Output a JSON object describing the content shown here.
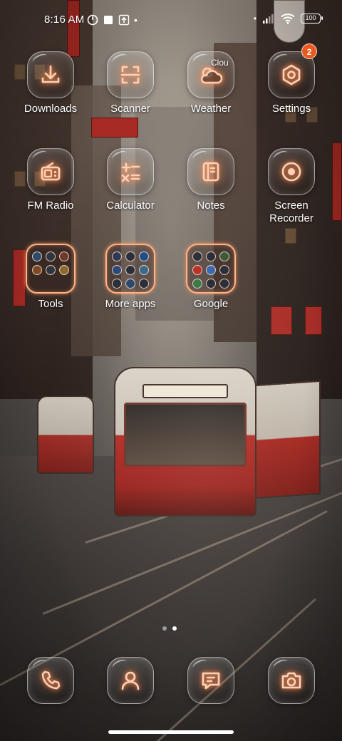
{
  "status_bar": {
    "time": "8:16 AM",
    "battery": "100"
  },
  "apps": [
    {
      "id": "downloads",
      "label": "Downloads",
      "icon": "download-icon"
    },
    {
      "id": "scanner",
      "label": "Scanner",
      "icon": "scanner-icon"
    },
    {
      "id": "weather",
      "label": "Weather",
      "icon": "weather-cloud-icon",
      "overlay_text": "Clou"
    },
    {
      "id": "settings",
      "label": "Settings",
      "icon": "gear-icon",
      "badge": "2"
    },
    {
      "id": "fm_radio",
      "label": "FM Radio",
      "icon": "radio-icon"
    },
    {
      "id": "calculator",
      "label": "Calculator",
      "icon": "calculator-icon"
    },
    {
      "id": "notes",
      "label": "Notes",
      "icon": "notes-icon"
    },
    {
      "id": "screen_recorder",
      "label": "Screen\nRecorder",
      "icon": "record-icon"
    }
  ],
  "folders": [
    {
      "id": "tools",
      "label": "Tools"
    },
    {
      "id": "more_apps",
      "label": "More apps"
    },
    {
      "id": "google",
      "label": "Google"
    }
  ],
  "dock": [
    {
      "id": "phone",
      "icon": "phone-icon"
    },
    {
      "id": "contacts",
      "icon": "contacts-icon"
    },
    {
      "id": "messages",
      "icon": "messages-icon"
    },
    {
      "id": "camera",
      "icon": "camera-icon"
    }
  ],
  "page_indicator": {
    "pages": 2,
    "current": 2
  },
  "colors": {
    "icon_glow": "#ff9a66",
    "badge": "#ea5a1f"
  }
}
